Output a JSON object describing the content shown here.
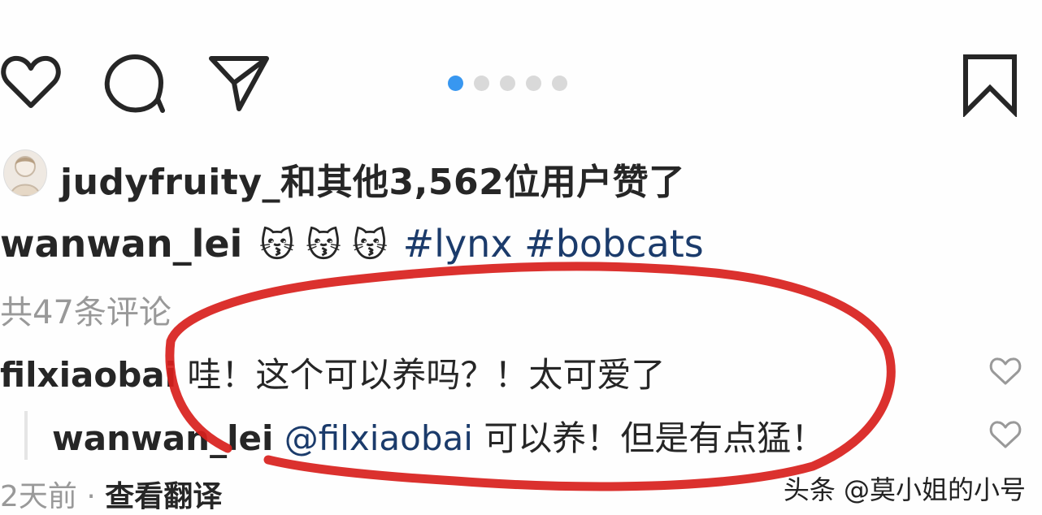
{
  "carousel": {
    "count": 5,
    "active_index": 0
  },
  "likes": {
    "text": "judyfruity_和其他3,562位用户赞了"
  },
  "caption": {
    "username": "wanwan_lei",
    "emojis": "😽 😽 😽",
    "hashtags": "#lynx #bobcats"
  },
  "comments_summary": "共47条评论",
  "comments": [
    {
      "username": "filxiaobai",
      "text": "哇！这个可以养吗？！太可爱了"
    },
    {
      "username": "wanwan_lei",
      "mention": "@filxiaobai",
      "text": "可以养！但是有点猛！"
    }
  ],
  "meta": {
    "time": "2天前",
    "separator": "·",
    "translate": "查看翻译"
  },
  "watermark": "头条 @莫小姐的小号",
  "colors": {
    "accent": "#3897f0",
    "annotation": "#d8201c"
  }
}
